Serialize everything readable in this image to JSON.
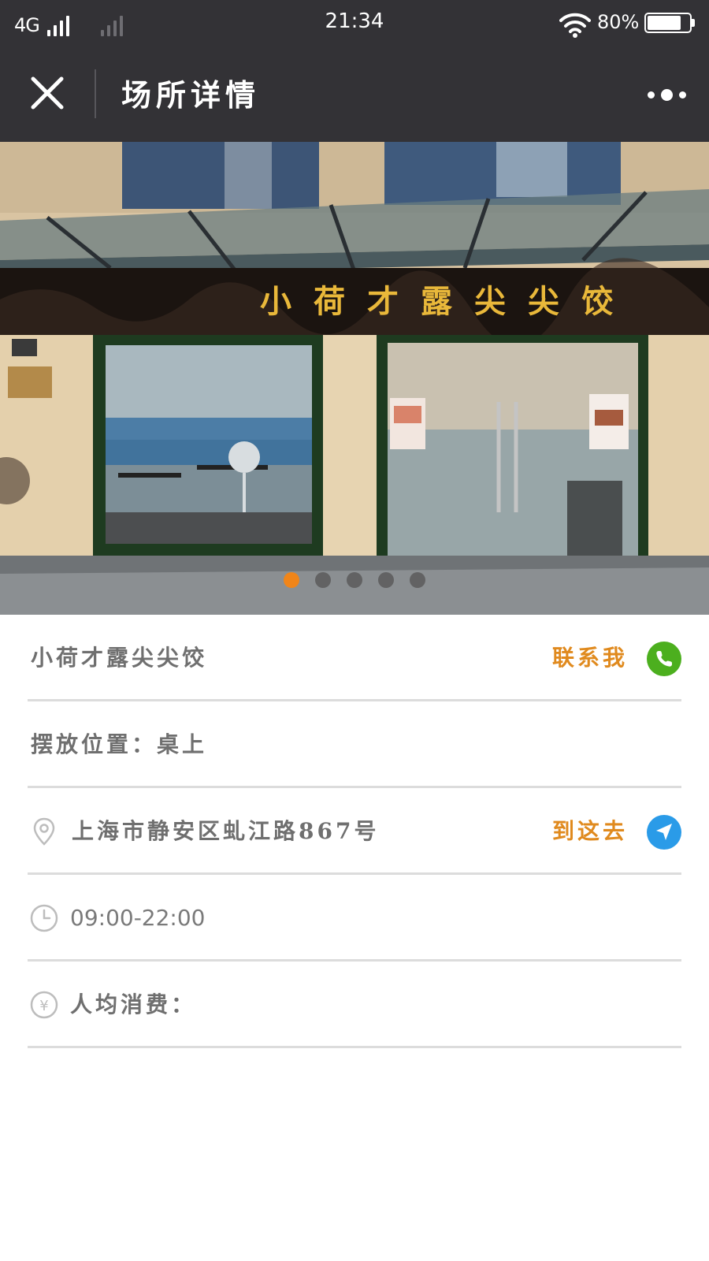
{
  "status_bar": {
    "network": "4G",
    "time": "21:34",
    "battery_percent_label": "80%",
    "battery_level": 0.8
  },
  "nav": {
    "title": "场所详情",
    "close_icon": "close-icon",
    "more_icon": "more-icon"
  },
  "carousel": {
    "storefront_sign": "小荷才露尖尖饺",
    "slide_count": 5,
    "active_index": 0,
    "active_color": "#f08519"
  },
  "place": {
    "name": "小荷才露尖尖饺",
    "contact_label": "联系我",
    "contact_color": "#4caf1e",
    "placement": "摆放位置：桌上",
    "address": "上海市静安区虬江路867号",
    "navigate_label": "到这去",
    "navigate_color": "#2a9be8",
    "hours": "09:00-22:00",
    "avg_spend_label": "人均消费："
  },
  "colors": {
    "header_bg": "#333236",
    "accent_orange": "#e08a1e"
  }
}
